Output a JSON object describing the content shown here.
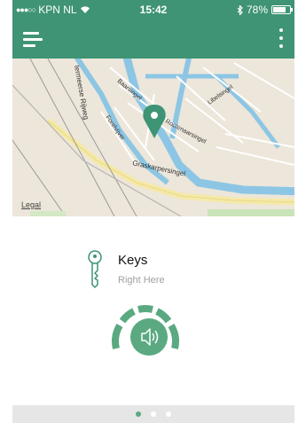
{
  "status_bar": {
    "carrier": "KPN NL",
    "time": "15:42",
    "battery": "78%",
    "battery_level": 0.78
  },
  "map": {
    "street_labels": [
      "termeerse Rijweg",
      "Baarsingel",
      "Forelvijver",
      "Rootenaarsingel",
      "Libelsingel",
      "Graskarpersingel"
    ],
    "legal": "Legal"
  },
  "item": {
    "name": "Keys",
    "status": "Right Here"
  },
  "pager": {
    "pages": 3,
    "active": 0
  },
  "colors": {
    "brand": "#3e9474",
    "accent": "#5aa981"
  },
  "icons": [
    "menu-icon",
    "more-vertical-icon",
    "location-pin-icon",
    "key-icon",
    "speaker-icon",
    "bluetooth-icon",
    "wifi-icon"
  ]
}
